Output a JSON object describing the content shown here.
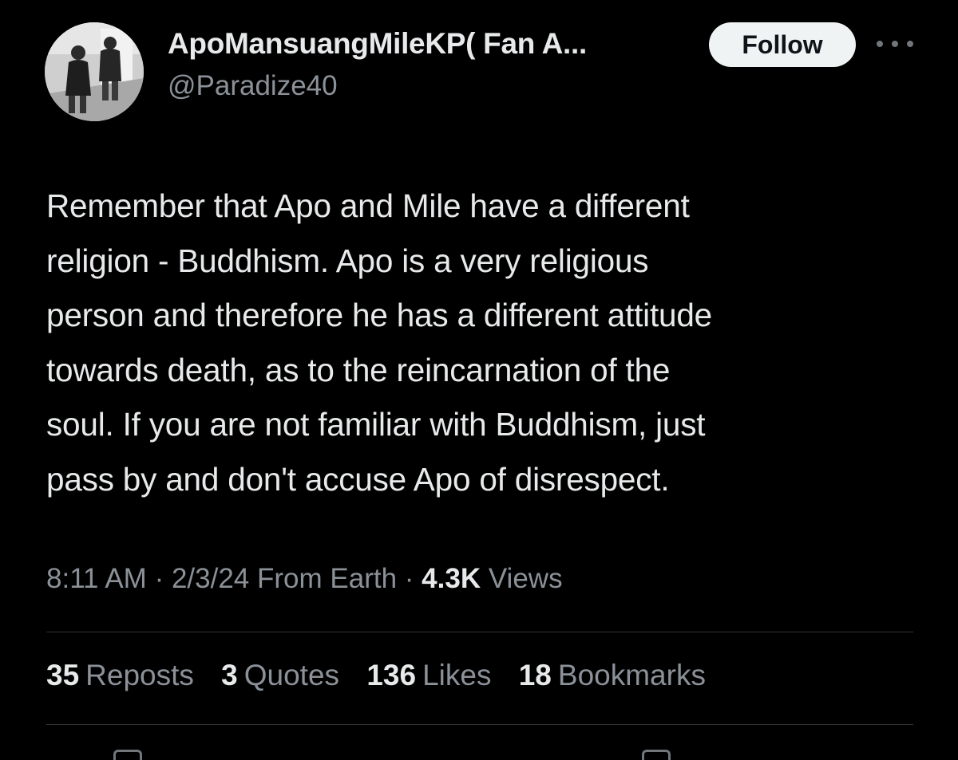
{
  "author": {
    "display_name": "ApoMansuangMileKP( Fan A...",
    "handle": "@Paradize40",
    "avatar_icon": "profile-photo"
  },
  "actions": {
    "follow_label": "Follow",
    "more_icon": "more-horizontal-icon"
  },
  "tweet": {
    "lines": [
      "Remember that Apo and Mile have a different",
      "religion - Buddhism. Apo is a very religious",
      "person and therefore he has a different attitude",
      "towards death, as to the reincarnation of the",
      "soul. If you are not familiar with Buddhism, just",
      "pass by and don't accuse Apo of disrespect."
    ]
  },
  "meta": {
    "time": "8:11 AM",
    "separator": "·",
    "date": "2/3/24",
    "source": "From Earth",
    "views_count": "4.3K",
    "views_label": "Views"
  },
  "stats": [
    {
      "count": "35",
      "label": "Reposts"
    },
    {
      "count": "3",
      "label": "Quotes"
    },
    {
      "count": "136",
      "label": "Likes"
    },
    {
      "count": "18",
      "label": "Bookmarks"
    }
  ],
  "colors": {
    "background": "#000000",
    "primary_text": "#e7e9ea",
    "secondary_text": "#8b9198",
    "divider": "#2f3336",
    "follow_button_bg": "#eff3f4"
  }
}
